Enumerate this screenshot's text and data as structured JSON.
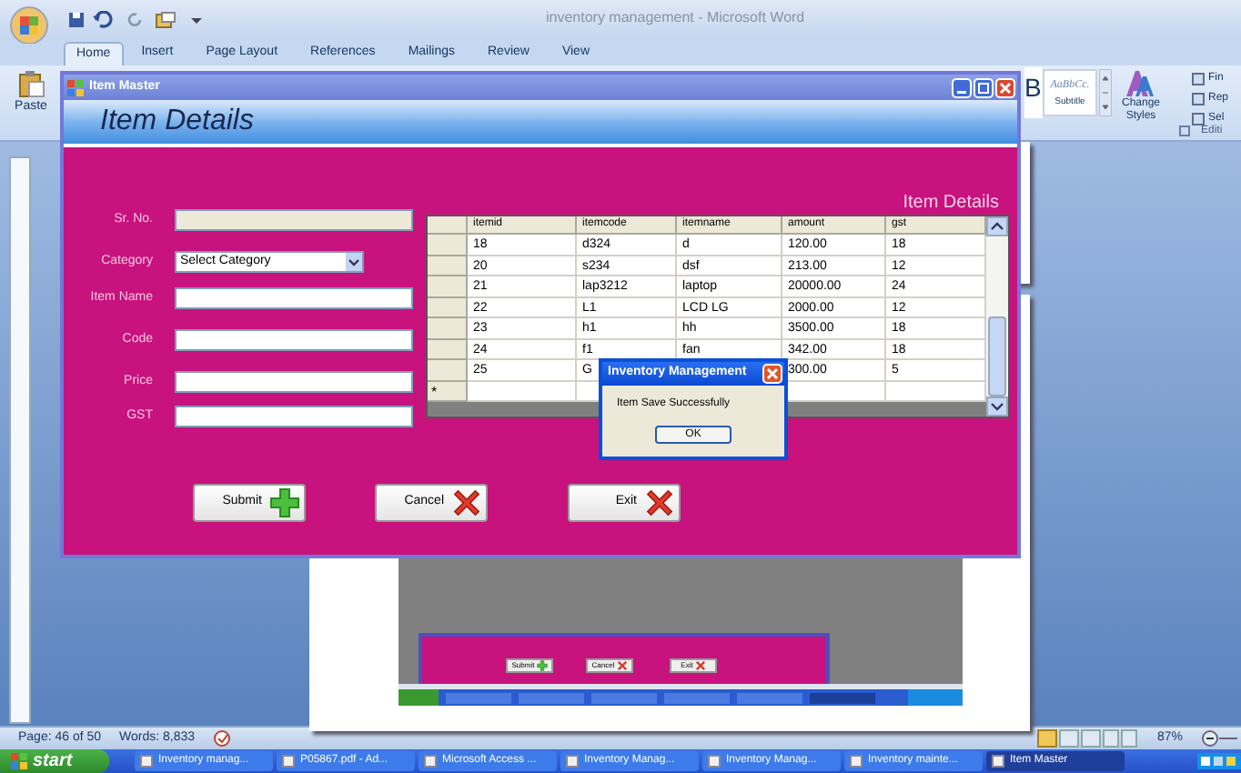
{
  "word": {
    "title": "inventory management - Microsoft Word",
    "ribbon_tabs": [
      {
        "label": "Home",
        "selected": true
      },
      {
        "label": "Insert",
        "selected": false
      },
      {
        "label": "Page Layout",
        "selected": false
      },
      {
        "label": "References",
        "selected": false
      },
      {
        "label": "Mailings",
        "selected": false
      },
      {
        "label": "Review",
        "selected": false
      },
      {
        "label": "View",
        "selected": false
      }
    ],
    "paste": "Paste",
    "style_partial": "B",
    "style_sample": "AaBbCc.",
    "style_name": "Subtitle",
    "change_styles": "Change Styles",
    "editing_items": [
      "Fin",
      "Rep",
      "Sel"
    ],
    "editing_group": "Editi"
  },
  "item_master": {
    "title": "Item Master",
    "header": "Item Details",
    "fields": [
      {
        "label": "Sr. No.",
        "kind": "text",
        "disabled": true
      },
      {
        "label": "Category",
        "kind": "select",
        "value": "Select Category"
      },
      {
        "label": "Item Name",
        "kind": "text",
        "disabled": false
      },
      {
        "label": "Code",
        "kind": "text",
        "disabled": false
      },
      {
        "label": "Price",
        "kind": "text",
        "disabled": false
      },
      {
        "label": "GST",
        "kind": "text",
        "disabled": false
      }
    ],
    "grid": {
      "caption": "Item Details",
      "new_row_marker": "*",
      "columns": [
        "itemid",
        "itemcode",
        "itemname",
        "amount",
        "gst"
      ],
      "rows": [
        [
          "18",
          "d324",
          "d",
          "120.00",
          "18"
        ],
        [
          "20",
          "s234",
          "dsf",
          "213.00",
          "12"
        ],
        [
          "21",
          "lap3212",
          "laptop",
          "20000.00",
          "24"
        ],
        [
          "22",
          "L1",
          "LCD LG",
          "2000.00",
          "12"
        ],
        [
          "23",
          "h1",
          "hh",
          "3500.00",
          "18"
        ],
        [
          "24",
          "f1",
          "fan",
          "342.00",
          "18"
        ],
        [
          "25",
          "G",
          null,
          "300.00",
          "5"
        ]
      ]
    },
    "buttons": [
      {
        "label": "Submit",
        "kind": "add"
      },
      {
        "label": "Cancel",
        "kind": "cancel"
      },
      {
        "label": "Exit",
        "kind": "cancel"
      }
    ]
  },
  "dialog": {
    "title": "Inventory Management",
    "message": "Item Save Successfully",
    "button": "OK"
  },
  "figure_buttons": [
    {
      "label": "Submit",
      "kind": "add"
    },
    {
      "label": "Cancel",
      "kind": "cancel"
    },
    {
      "label": "Exit",
      "kind": "cancel"
    }
  ],
  "status_bar": {
    "page": "Page: 46 of 50",
    "words": "Words: 8,833",
    "zoom": "87%"
  },
  "taskbar": {
    "start": "start",
    "items": [
      {
        "label": "Inventory manag...",
        "selected": false
      },
      {
        "label": "P05867.pdf - Ad...",
        "selected": false
      },
      {
        "label": "Microsoft Access ...",
        "selected": false
      },
      {
        "label": "Inventory Manag...",
        "selected": false
      },
      {
        "label": "Inventory Manag...",
        "selected": false
      },
      {
        "label": "Inventory mainte...",
        "selected": false
      },
      {
        "label": "Item Master",
        "selected": true
      }
    ]
  }
}
